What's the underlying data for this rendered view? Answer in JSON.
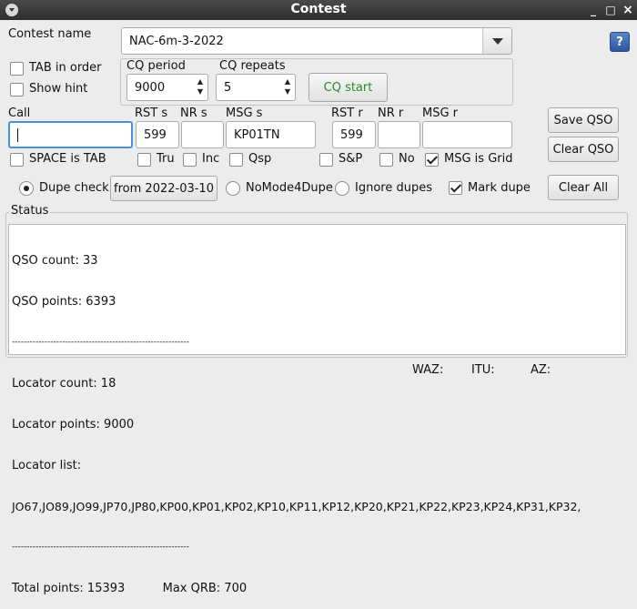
{
  "window": {
    "title": "Contest",
    "minimize": "_",
    "maximize": "□",
    "close": "×"
  },
  "contest": {
    "label": "Contest name",
    "value": "NAC-6m-3-2022",
    "help_label": "?"
  },
  "options": {
    "tab_in_order": "TAB in order",
    "show_hint": "Show hint"
  },
  "cq": {
    "period_label": "CQ period",
    "period_value": "9000",
    "repeats_label": "CQ repeats",
    "repeats_value": "5",
    "start_label": "CQ start"
  },
  "qso": {
    "call_label": "Call",
    "call_value": "",
    "rst_s_label": "RST s",
    "rst_s_value": "599",
    "nr_s_label": "NR s",
    "nr_s_value": "",
    "msg_s_label": "MSG s",
    "msg_s_value": "KP01TN",
    "rst_r_label": "RST r",
    "rst_r_value": "599",
    "nr_r_label": "NR r",
    "nr_r_value": "",
    "msg_r_label": "MSG r",
    "msg_r_value": "",
    "save_label": "Save QSO",
    "clear_label": "Clear QSO"
  },
  "checks": {
    "space_is_tab": "SPACE is TAB",
    "tru": "Tru",
    "inc": "Inc",
    "qsp": "Qsp",
    "sp": "S&P",
    "no": "No",
    "msg_is_grid": "MSG is Grid"
  },
  "dupe": {
    "dupe_check": "Dupe check",
    "from_date": "from 2022-03-10",
    "nomode": "NoMode4Dupe",
    "ignore": "Ignore dupes",
    "mark": "Mark dupe",
    "clear_all": "Clear All"
  },
  "status": {
    "title": "Status",
    "lines": [
      "QSO count: 33",
      "QSO points: 6393",
      "------------------------------------------------------------",
      "Locator count: 18",
      "Locator points: 9000",
      "Locator list:",
      "JO67,JO89,JO99,JP70,JP80,KP00,KP01,KP02,KP10,KP11,KP12,KP20,KP21,KP22,KP23,KP24,KP31,KP32,",
      "------------------------------------------------------------",
      "Total points: 15393          Max QRB: 700"
    ]
  },
  "footer": {
    "waz": "WAZ:",
    "itu": "ITU:",
    "az": "AZ:"
  }
}
